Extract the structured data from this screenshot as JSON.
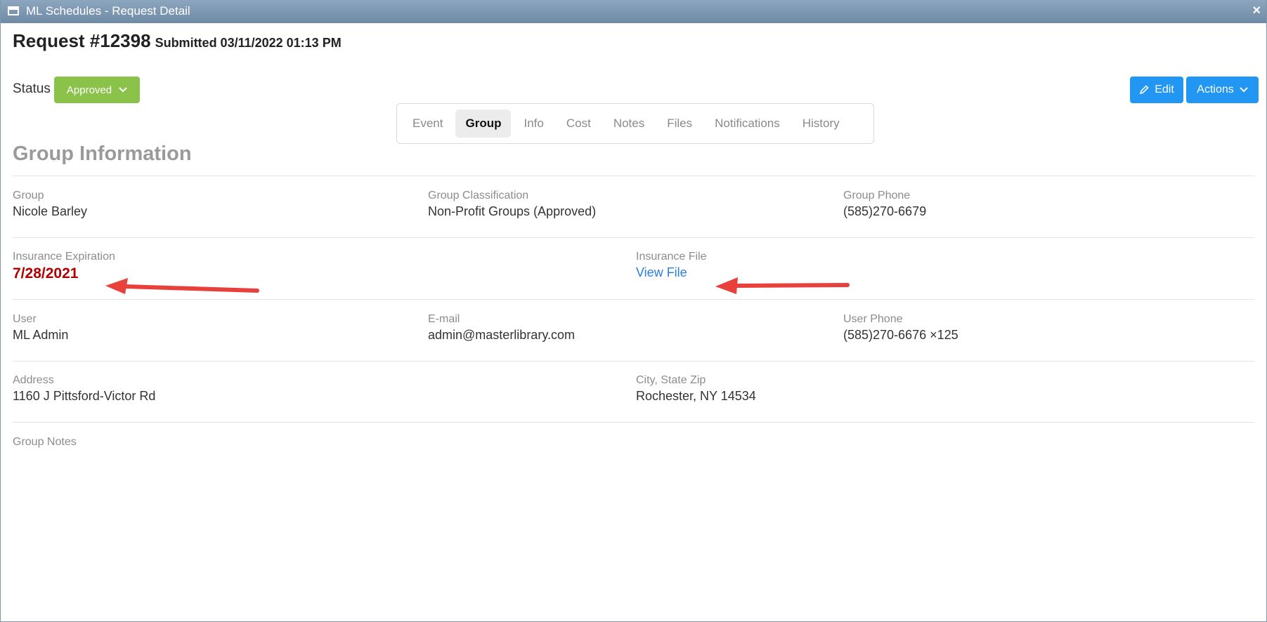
{
  "window": {
    "title": "ML Schedules - Request Detail",
    "close": "×"
  },
  "request": {
    "number": "Request #12398",
    "submitted": "Submitted 03/11/2022 01:13 PM"
  },
  "status": {
    "label": "Status",
    "value": "Approved",
    "color": "#8bc34a"
  },
  "buttons": {
    "edit": "Edit",
    "actions": "Actions",
    "color": "#2196f3"
  },
  "tabs": [
    "Event",
    "Group",
    "Info",
    "Cost",
    "Notes",
    "Files",
    "Notifications",
    "History"
  ],
  "active_tab": "Group",
  "section": {
    "title": "Group Information"
  },
  "fields": {
    "group": {
      "label": "Group",
      "value": "Nicole Barley"
    },
    "classification": {
      "label": "Group Classification",
      "value": "Non-Profit Groups (Approved)"
    },
    "group_phone": {
      "label": "Group Phone",
      "value": "(585)270-6679"
    },
    "insurance_expiration": {
      "label": "Insurance Expiration",
      "value": "7/28/2021",
      "color": "#b00000"
    },
    "insurance_file": {
      "label": "Insurance File",
      "value": "View File"
    },
    "user": {
      "label": "User",
      "value": "ML Admin"
    },
    "email": {
      "label": "E-mail",
      "value": "admin@masterlibrary.com"
    },
    "user_phone": {
      "label": "User Phone",
      "value": "(585)270-6676 ×125"
    },
    "address": {
      "label": "Address",
      "value": "1160 J Pittsford-Victor Rd"
    },
    "city_state_zip": {
      "label": "City, State Zip",
      "value": "Rochester, NY 14534"
    },
    "group_notes": {
      "label": "Group Notes",
      "value": ""
    }
  },
  "annotation_color": "#e8413c"
}
